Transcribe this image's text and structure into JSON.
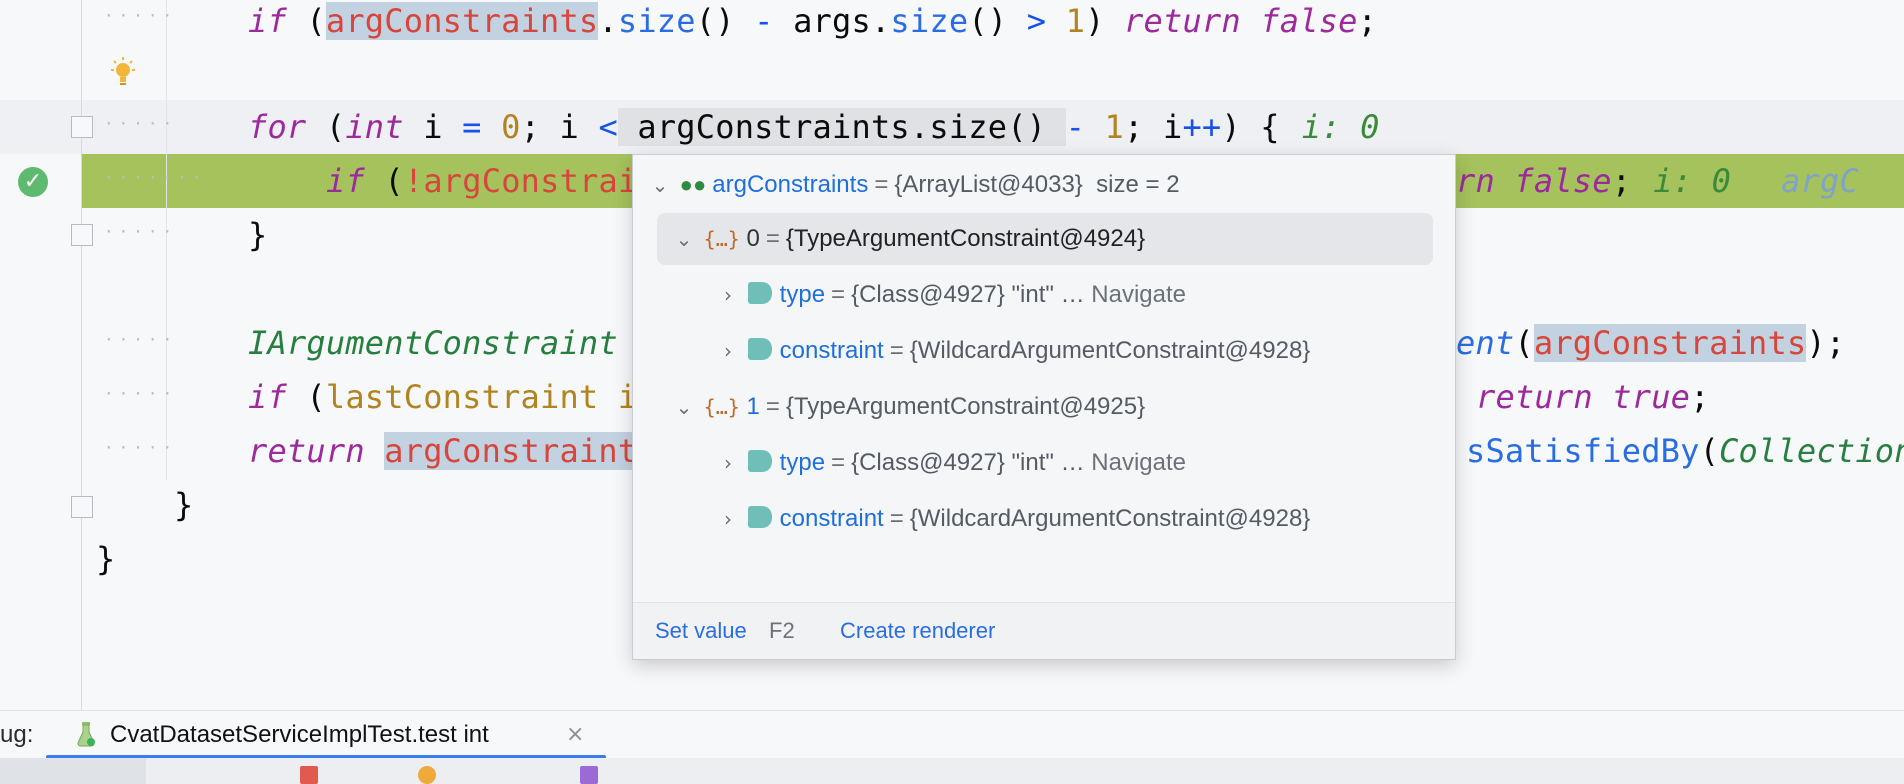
{
  "code": {
    "line1": {
      "if_kw": "if",
      "open": " (",
      "field": "argConstraints",
      "dot": ".",
      "size_fn": "size",
      "paren": "()",
      "minus": " - ",
      "args": "args.",
      "size2": "size",
      "paren2": "()",
      "gt": " > ",
      "one": "1",
      "close": ") ",
      "ret": "return",
      "false": "false",
      "semi": ";"
    },
    "line3": {
      "for_kw": "for",
      "open": " (",
      "int_kw": "int",
      "rest1": " i ",
      "eq": "=",
      "zero": " 0",
      "semi1": "; i ",
      "lt": "<",
      "hl": " argConstraints.size() ",
      "minus": "-",
      "one": " 1",
      "semi2": "; i",
      "pp": "++",
      "close": ") {",
      "inline": "i: 0"
    },
    "line4": {
      "if_kw": "if",
      "open": " (",
      "not": "!",
      "field": "argConstrai",
      "tail_kw": "rn",
      "tail_false": "false",
      "semi": ";",
      "inline": "i: 0",
      "inline2": "argC"
    },
    "line5": {
      "brace": "}"
    },
    "line7": {
      "cls": "IArgumentConstraint",
      "tail_fn": "ent",
      "open": "(",
      "field": "argConstraints",
      "close": ");"
    },
    "line8": {
      "if_kw": "if",
      "open": " (",
      "var": "lastConstraint",
      "rest": " i",
      "ret": "return",
      "true": "true",
      "semi": ";"
    },
    "line9": {
      "ret": "return",
      "field": "argConstraint",
      "fn": "sSatisfiedBy",
      "open": "(",
      "cls": "Collection"
    },
    "line10": {
      "brace": "}"
    },
    "line11": {
      "brace": "}"
    }
  },
  "popup": {
    "root": {
      "name": "argConstraints",
      "value": "{ArrayList@4033}",
      "size": "size = 2"
    },
    "items": [
      {
        "index": "0",
        "value": "{TypeArgumentConstraint@4924}",
        "children": [
          {
            "name": "type",
            "value": "{Class@4927} \"int\"",
            "more": "…",
            "nav": "Navigate"
          },
          {
            "name": "constraint",
            "value": "{WildcardArgumentConstraint@4928}"
          }
        ]
      },
      {
        "index": "1",
        "value": "{TypeArgumentConstraint@4925}",
        "children": [
          {
            "name": "type",
            "value": "{Class@4927} \"int\"",
            "more": "…",
            "nav": "Navigate"
          },
          {
            "name": "constraint",
            "value": "{WildcardArgumentConstraint@4928}"
          }
        ]
      }
    ],
    "footer": {
      "set_value": "Set value",
      "set_value_key": "F2",
      "create_renderer": "Create renderer"
    }
  },
  "debug": {
    "label": "ug:",
    "tab_title": "CvatDatasetServiceImplTest.test int",
    "close": "×"
  },
  "colors": {
    "exec_line": "#a5c25c",
    "accent": "#3b7cf0",
    "link": "#2a6de0"
  },
  "icons": [
    "lightbulb-icon",
    "execution-point-icon",
    "fold-icon",
    "watch-glasses-icon",
    "object-icon",
    "field-tag-icon",
    "test-flask-icon",
    "close-icon"
  ]
}
